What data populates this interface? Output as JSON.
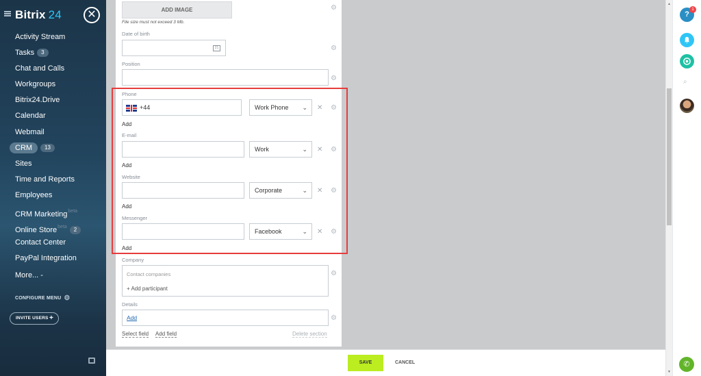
{
  "sidebar": {
    "logo_main": "Bitrix",
    "logo_num": "24",
    "close_glyph": "✕",
    "menu": [
      {
        "label": "Activity Stream"
      },
      {
        "label": "Tasks",
        "badge": "3"
      },
      {
        "label": "Chat and Calls"
      },
      {
        "label": "Workgroups"
      },
      {
        "label": "Bitrix24.Drive"
      },
      {
        "label": "Calendar"
      },
      {
        "label": "Webmail"
      },
      {
        "label": "CRM",
        "badge": "13"
      },
      {
        "label": "Sites"
      },
      {
        "label": "Time and Reports"
      },
      {
        "label": "Employees"
      },
      {
        "label": "CRM Marketing",
        "beta": "beta"
      },
      {
        "label": "Online Store",
        "beta": "beta",
        "badge": "2"
      },
      {
        "label": "Contact Center"
      },
      {
        "label": "PayPal Integration"
      },
      {
        "label": "More... -"
      }
    ],
    "configure_menu": "CONFIGURE MENU",
    "invite_users": "INVITE USERS"
  },
  "form": {
    "add_image": "ADD IMAGE",
    "file_note": "File size must not exceed 3 Mb.",
    "date_of_birth_label": "Date of birth",
    "position_label": "Position",
    "phone_label": "Phone",
    "phone_value": "+44",
    "phone_type": "Work Phone",
    "add": "Add",
    "email_label": "E-mail",
    "email_type": "Work",
    "website_label": "Website",
    "website_type": "Corporate",
    "messenger_label": "Messenger",
    "messenger_type": "Facebook",
    "company_label": "Company",
    "contact_companies_placeholder": "Contact companies",
    "add_participant": "+ Add participant",
    "details_label": "Details",
    "details_add": "Add",
    "select_field": "Select field",
    "add_field": "Add field",
    "delete_section": "Delete section"
  },
  "footer": {
    "save": "SAVE",
    "cancel": "CANCEL"
  },
  "rightpanel": {
    "help": "?",
    "help_count": "1"
  },
  "colors": {
    "accent": "#2fc6f6",
    "save_green": "#bbed21",
    "highlight_red": "#e63c3c",
    "link_blue": "#2067b0"
  }
}
